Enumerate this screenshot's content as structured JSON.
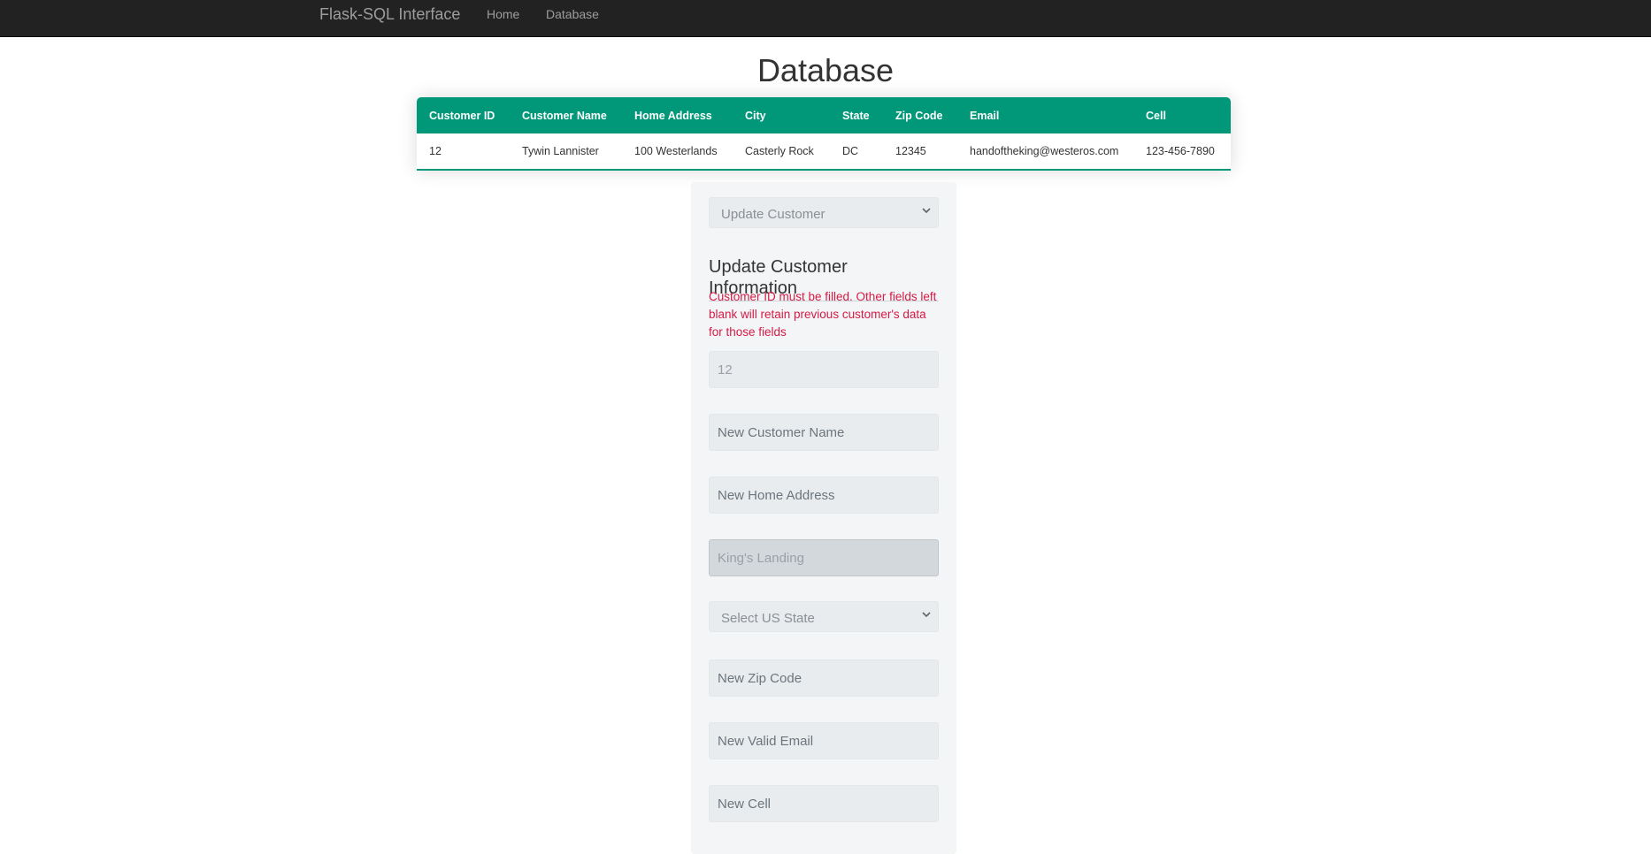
{
  "navbar": {
    "brand": "Flask-SQL Interface",
    "links": [
      "Home",
      "Database"
    ]
  },
  "page": {
    "title": "Database"
  },
  "table": {
    "headers": [
      "Customer ID",
      "Customer Name",
      "Home Address",
      "City",
      "State",
      "Zip Code",
      "Email",
      "Cell"
    ],
    "rows": [
      [
        "12",
        "Tywin Lannister",
        "100 Westerlands",
        "Casterly Rock",
        "DC",
        "12345",
        "handoftheking@westeros.com",
        "123-456-7890"
      ]
    ]
  },
  "form": {
    "action_select": "Update Customer",
    "title": "Update Customer Information",
    "notice": "Customer ID must be filled. Other fields left blank will retain previous customer's data for those fields",
    "customer_id_value": "12",
    "name_placeholder": "New Customer Name",
    "address_placeholder": "New Home Address",
    "city_value": "King's Landing",
    "state_select": "Select US State",
    "zip_placeholder": "New Zip Code",
    "email_placeholder": "New Valid Email",
    "cell_placeholder": "New Cell"
  },
  "colors": {
    "navbar_bg": "#222222",
    "table_header_bg": "#009879",
    "notice_text": "#d51b45"
  }
}
